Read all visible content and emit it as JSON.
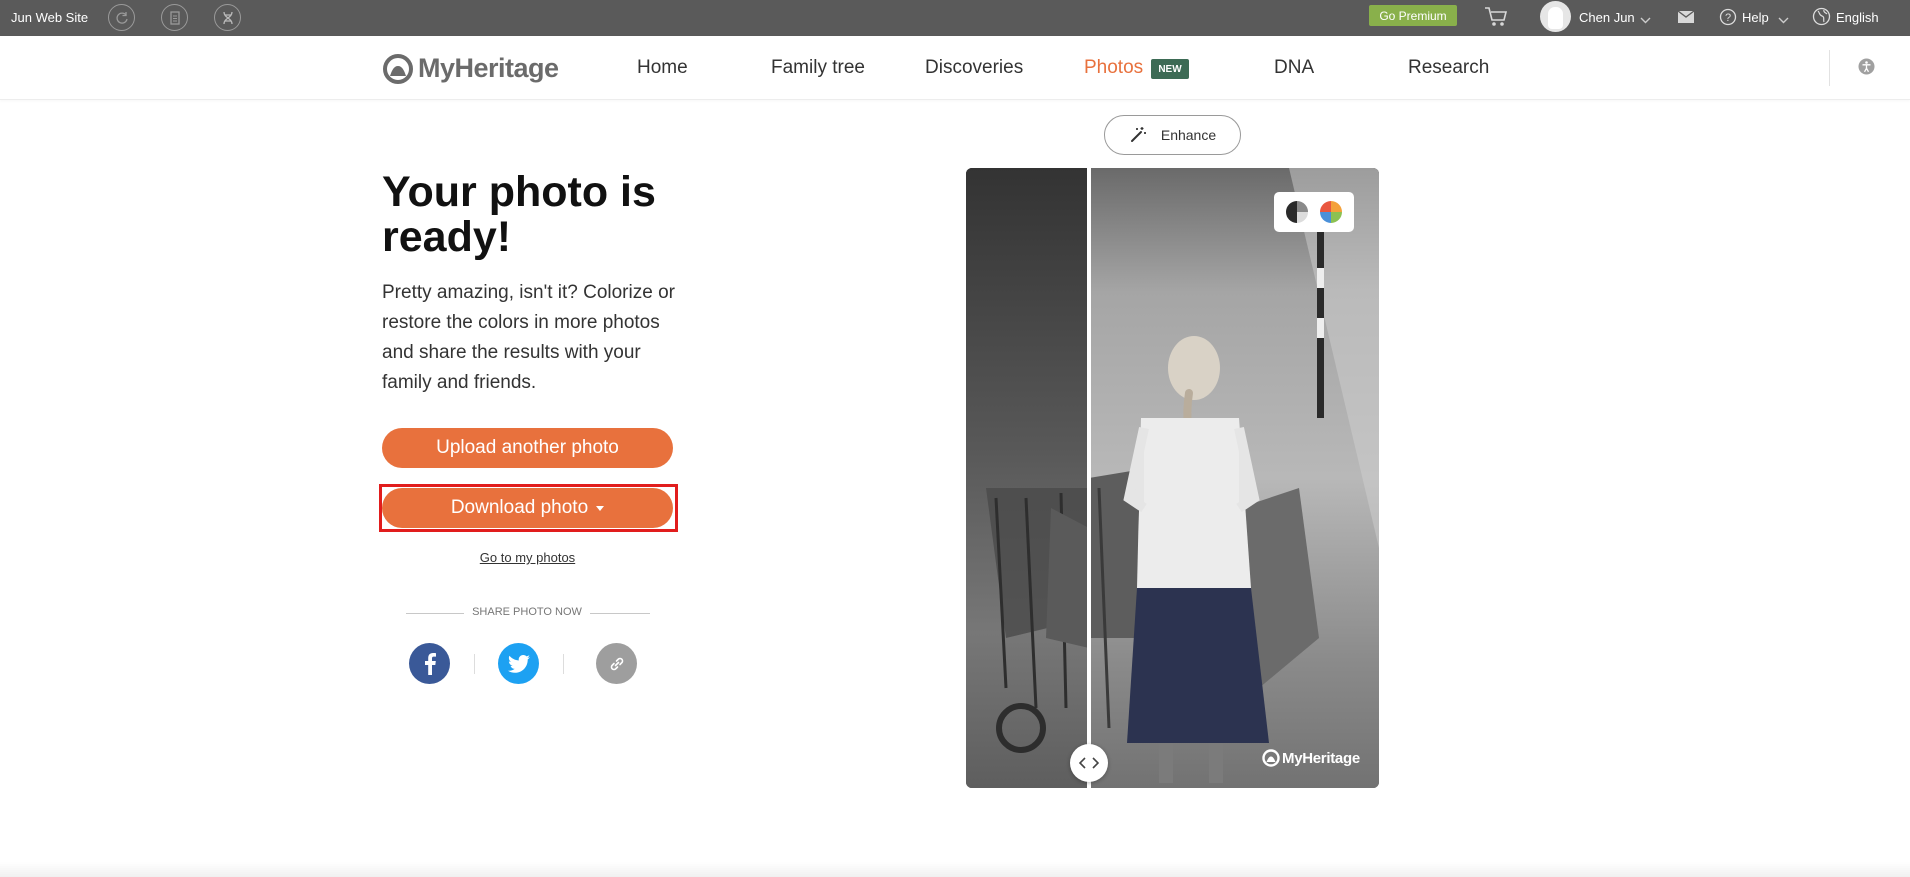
{
  "topbar": {
    "site_name": "Jun Web Site",
    "go_premium": "Go Premium",
    "user_name": "Chen Jun",
    "help": "Help",
    "language": "English"
  },
  "nav": {
    "logo": "MyHeritage",
    "items": [
      "Home",
      "Family tree",
      "Discoveries",
      "Photos",
      "DNA",
      "Research"
    ],
    "active": "Photos",
    "new_badge": "NEW"
  },
  "main": {
    "title": "Your photo is ready!",
    "description": "Pretty amazing, isn't it? Colorize or restore the colors in more photos and share the results with your family and friends.",
    "upload_button": "Upload another photo",
    "download_button": "Download photo",
    "go_to_photos": "Go to my photos",
    "share_label": "SHARE PHOTO NOW"
  },
  "photo": {
    "enhance_label": "Enhance",
    "watermark": "MyHeritage"
  },
  "colors": {
    "accent": "#e8713d",
    "premium": "#89b04b",
    "badge": "#3d6b55",
    "highlight": "#e11d1d",
    "facebook": "#3a5998",
    "twitter": "#1da1f2"
  }
}
